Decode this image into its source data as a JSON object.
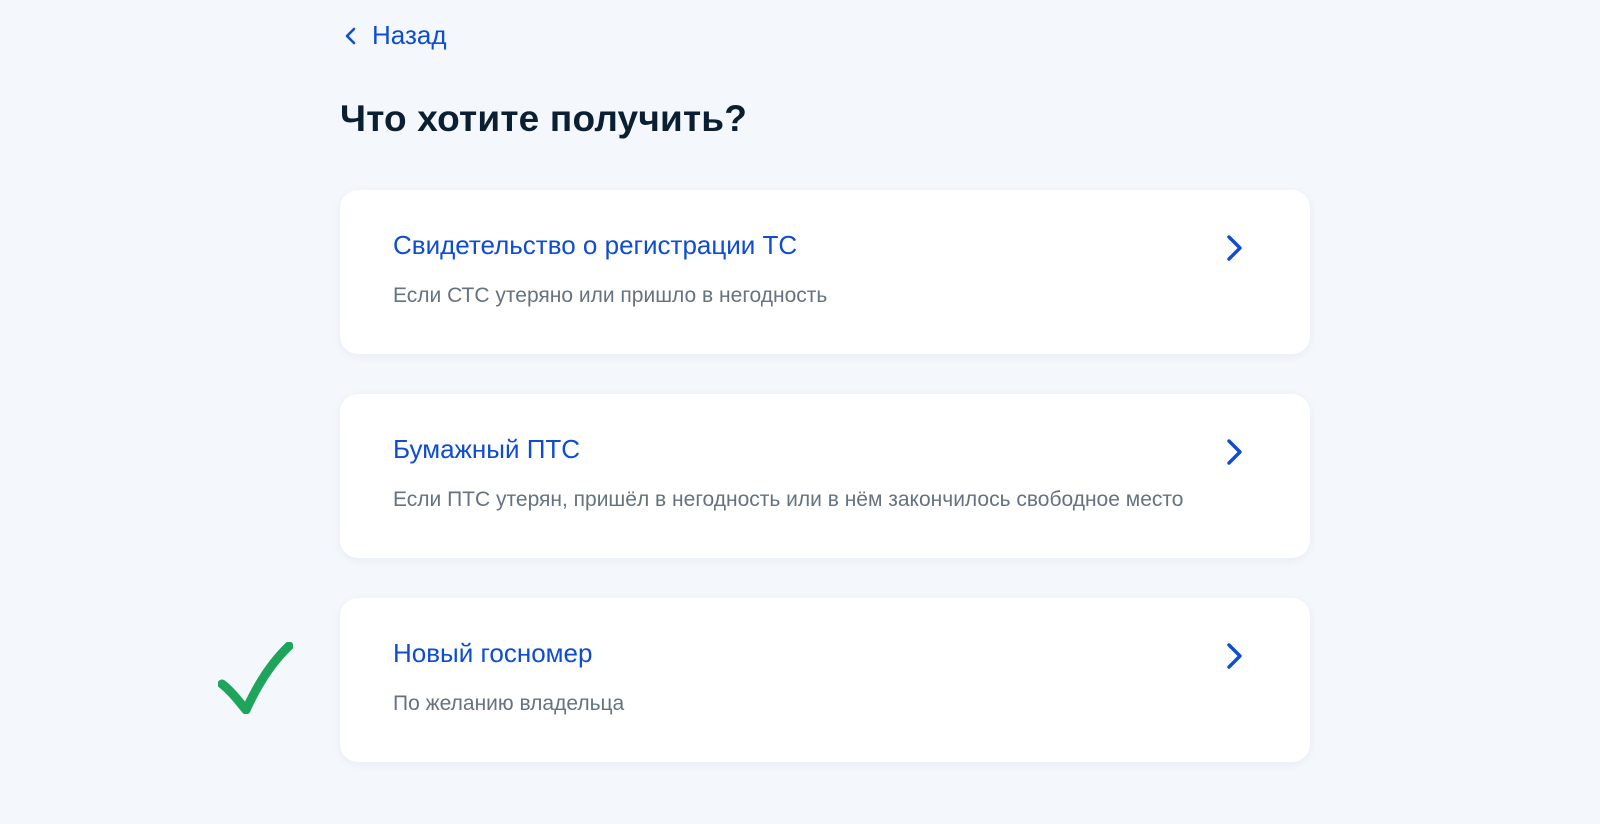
{
  "back": {
    "label": "Назад"
  },
  "page": {
    "title": "Что хотите получить?"
  },
  "options": [
    {
      "title": "Свидетельство о регистрации ТС",
      "description": "Если СТС утеряно или пришло в негодность"
    },
    {
      "title": "Бумажный ПТС",
      "description": "Если ПТС утерян, пришёл в негодность или в нём закончилось свободное место"
    },
    {
      "title": "Новый госномер",
      "description": "По желанию владельца"
    }
  ],
  "icons": {
    "back": "chevron-left-icon",
    "option_arrow": "chevron-right-icon",
    "selection_marker": "checkmark-icon"
  },
  "colors": {
    "background": "#f4f7fc",
    "card": "#ffffff",
    "link": "#0d4cd3",
    "title": "#0b1f33",
    "description": "#66727f",
    "checkmark": "#1ea55b"
  }
}
